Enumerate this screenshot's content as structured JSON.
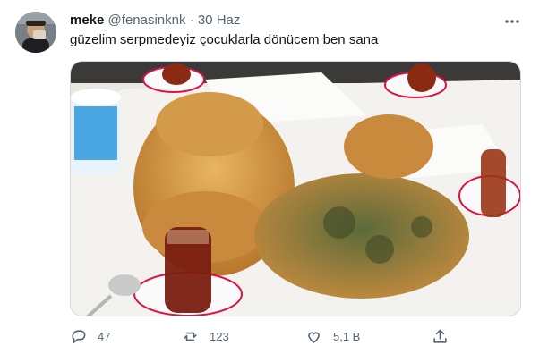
{
  "tweet": {
    "display_name": "meke",
    "handle": "@fenasinknk",
    "separator": "·",
    "date": "30 Haz",
    "text": "güzelim serpmedeyiz çocuklarla dönücem ben sana",
    "media": {
      "icon": "photo"
    },
    "actions": {
      "reply_count": "47",
      "retweet_count": "123",
      "like_count": "5,1 B"
    }
  },
  "colors": {
    "text_primary": "#0f1419",
    "text_secondary": "#536471",
    "border": "#cfd9de"
  }
}
